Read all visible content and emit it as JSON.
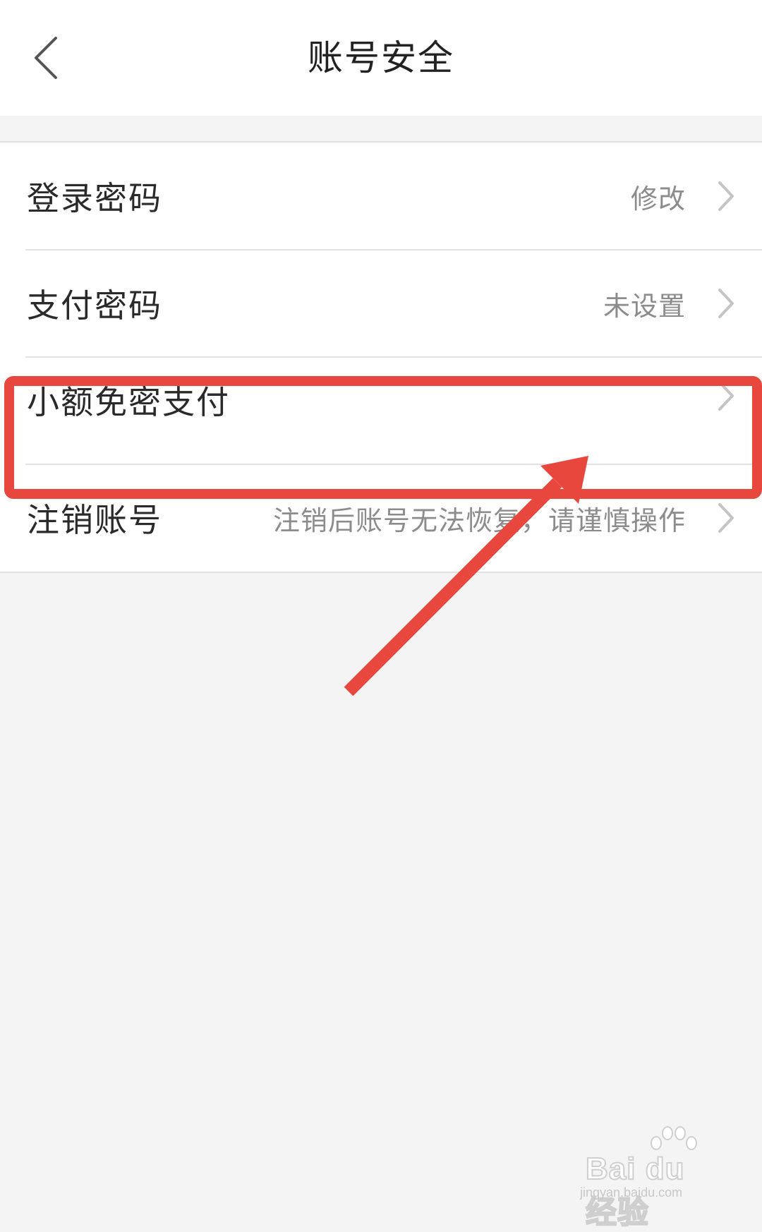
{
  "header": {
    "title": "账号安全",
    "back_icon": "chevron-left-icon"
  },
  "settings": {
    "items": [
      {
        "label": "登录密码",
        "value": "修改"
      },
      {
        "label": "支付密码",
        "value": "未设置"
      },
      {
        "label": "小额免密支付",
        "value": ""
      },
      {
        "label": "注销账号",
        "value": "注销后账号无法恢复，请谨慎操作"
      }
    ]
  },
  "annotation": {
    "color": "#e8473d",
    "target": "小额免密支付"
  },
  "watermark": {
    "brand": "Bai du 经验",
    "url": "jingyan.baidu.com"
  },
  "colors": {
    "background": "#f4f4f4",
    "surface": "#ffffff",
    "divider": "#e2e2e2",
    "secondary_text": "#8c8c8c"
  }
}
